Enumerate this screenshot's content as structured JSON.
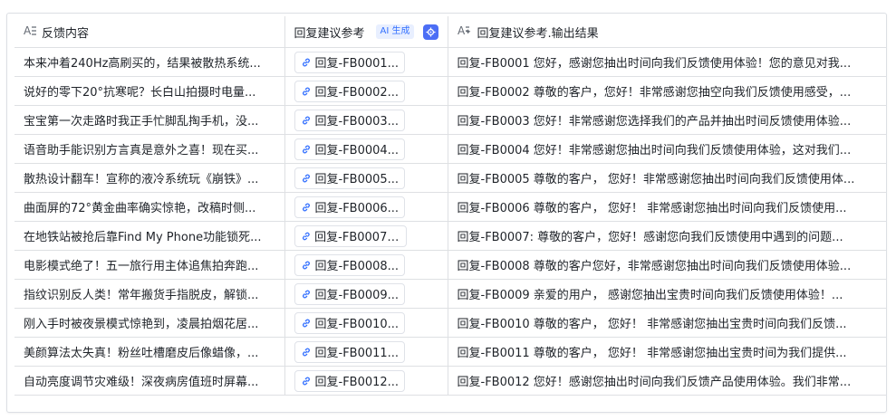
{
  "columns": {
    "feedback": "反馈内容",
    "reply_ref": "回复建议参考",
    "ai_badge": "AI 生成",
    "output": "回复建议参考.输出结果"
  },
  "rows": [
    {
      "feedback": "本来冲着240Hz高刷买的，结果被散热系统...",
      "reply": "回复-FB0001...",
      "output": "回复-FB0001 您好，感谢您抽出时间向我们反馈使用体验！您的意见对我..."
    },
    {
      "feedback": "说好的零下20°抗寒呢？长白山拍摄时电量...",
      "reply": "回复-FB0002...",
      "output": "回复-FB0002 尊敬的客户，您好！非常感谢您抽空向我们反馈使用感受，..."
    },
    {
      "feedback": "宝宝第一次走路时我正手忙脚乱掏手机，没...",
      "reply": "回复-FB0003...",
      "output": "回复-FB0003 您好！非常感谢您选择我们的产品并抽出时间反馈使用体验..."
    },
    {
      "feedback": "语音助手能识别方言真是意外之喜！现在买...",
      "reply": "回复-FB0004...",
      "output": "回复-FB0004 您好！非常感谢您抽出时间向我们反馈使用体验，这对我们..."
    },
    {
      "feedback": "散热设计翻车！宣称的液冷系统玩《崩铁》...",
      "reply": "回复-FB0005...",
      "output": "回复-FB0005 尊敬的客户，  您好！非常感谢您抽出时间向我们反馈使用体..."
    },
    {
      "feedback": "曲面屏的72°黄金曲率确实惊艳，改稿时侧...",
      "reply": "回复-FB0006...",
      "output": "回复-FB0006 尊敬的客户，  您好！  非常感谢您抽出时间向我们反馈使用..."
    },
    {
      "feedback": "在地铁站被抢后靠Find My Phone功能锁死...",
      "reply": "回复-FB0007:...",
      "output": "回复-FB0007:   尊敬的客户，您好！感谢您向我们反馈使用中遇到的问题..."
    },
    {
      "feedback": "电影模式绝了！五一旅行用主体追焦拍奔跑...",
      "reply": "回复-FB0008...",
      "output": "回复-FB0008 尊敬的客户您好，非常感谢您抽出时间向我们反馈使用体验..."
    },
    {
      "feedback": "指纹识别反人类！常年搬货手指脱皮，解锁...",
      "reply": "回复-FB0009...",
      "output": "回复-FB0009 亲爱的用户，  感谢您抽出宝贵时间向我们反馈使用体验！..."
    },
    {
      "feedback": "刚入手时被夜景模式惊艳到，凌晨拍烟花居...",
      "reply": "回复-FB0010...",
      "output": "回复-FB0010 尊敬的客户，  您好！  非常感谢您抽出宝贵时间向我们反馈..."
    },
    {
      "feedback": "美颜算法太失真！粉丝吐槽磨皮后像蜡像，...",
      "reply": "回复-FB0011...",
      "output": "回复-FB0011 尊敬的客户，  您好！  非常感谢您抽出宝贵时间为我们提供..."
    },
    {
      "feedback": "自动亮度调节灾难级！深夜病房值班时屏幕...",
      "reply": "回复-FB0012...",
      "output": "回复-FB0012 您好！感谢您抽出时间向我们反馈产品使用体验。我们非常..."
    }
  ],
  "colors": {
    "accent": "#3370ff",
    "border": "#dee0e3",
    "chip_border": "#dfe2e8"
  },
  "icons": {
    "text_field": "text-field-icon",
    "ai_text_field": "ai-text-field-icon",
    "link": "link-icon",
    "settings": "ai-settings-icon"
  }
}
